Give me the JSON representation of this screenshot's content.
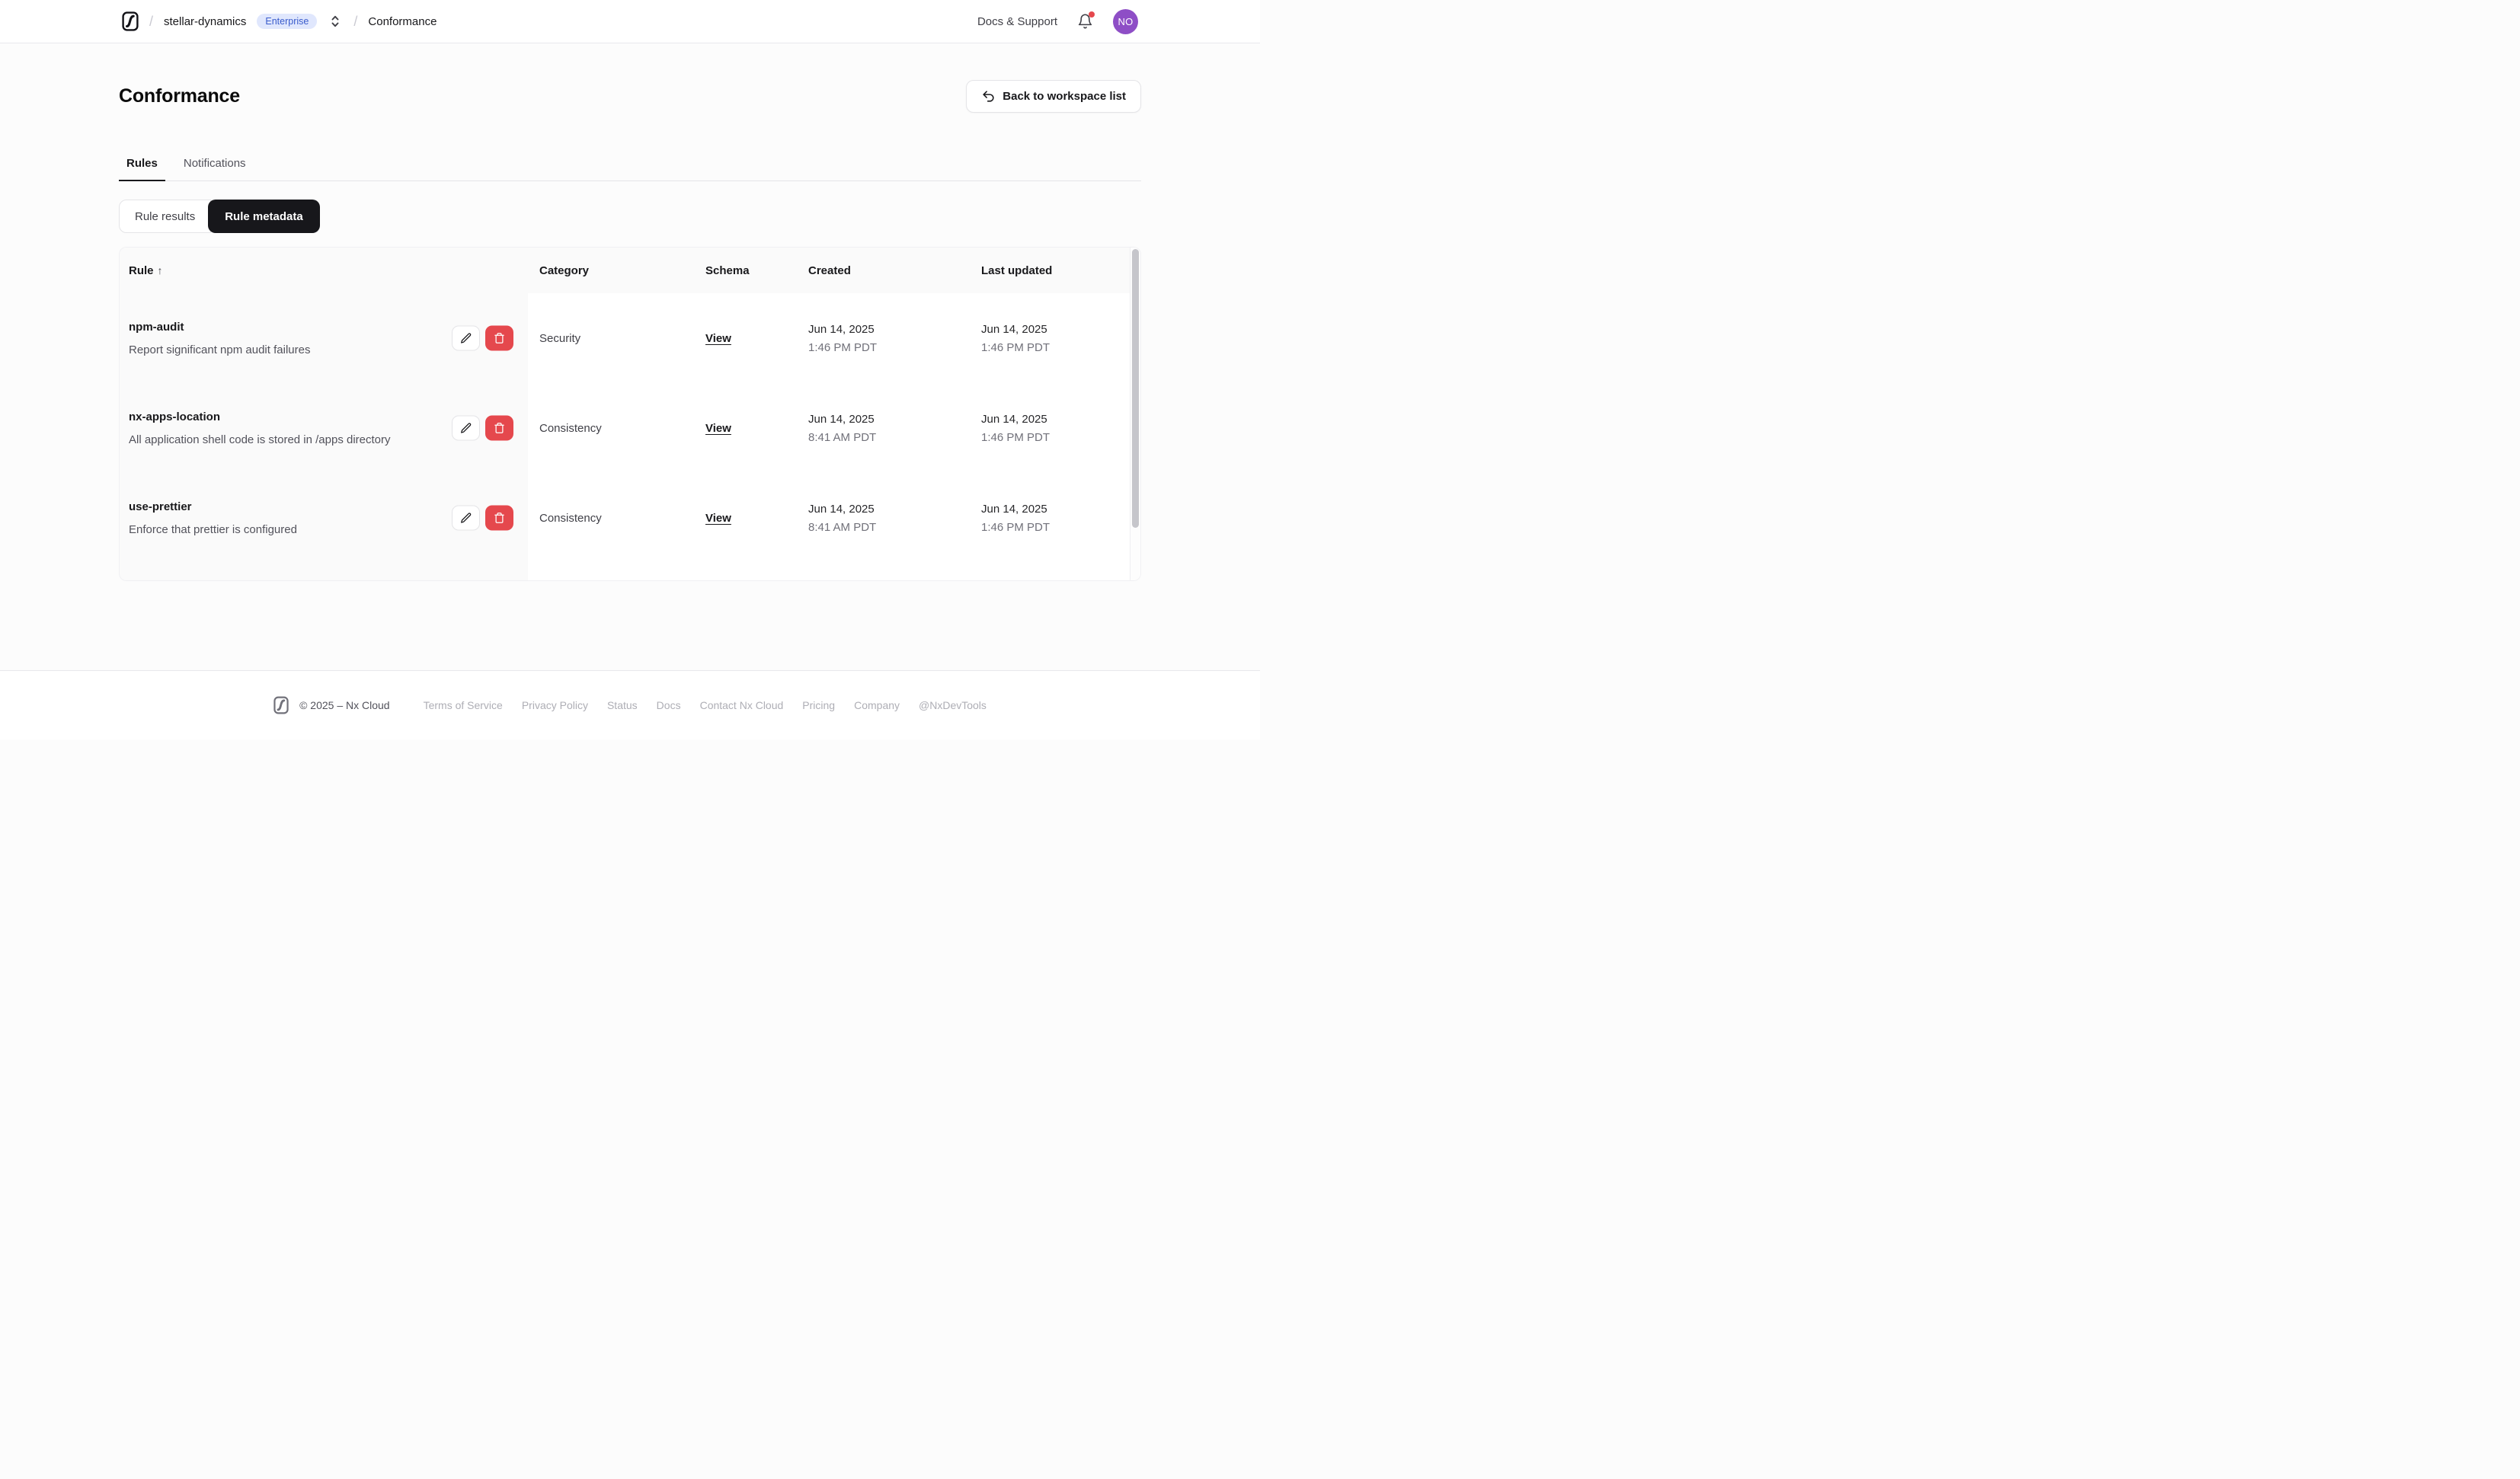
{
  "nav": {
    "breadcrumb": {
      "separator": "/",
      "workspace": "stellar-dynamics",
      "plan_badge": "Enterprise",
      "page": "Conformance"
    },
    "docs_support": "Docs & Support",
    "avatar_initials": "NO"
  },
  "page": {
    "title": "Conformance",
    "back_button": "Back to workspace list"
  },
  "tabs": [
    {
      "label": "Rules",
      "active": true
    },
    {
      "label": "Notifications",
      "active": false
    }
  ],
  "segmented": [
    {
      "label": "Rule results",
      "active": false
    },
    {
      "label": "Rule metadata",
      "active": true
    }
  ],
  "table": {
    "columns": [
      "Rule",
      "Category",
      "Schema",
      "Created",
      "Last updated"
    ],
    "sort_indicator": "↑",
    "rows": [
      {
        "name": "npm-audit",
        "description": "Report significant npm audit failures",
        "category": "Security",
        "schema_label": "View",
        "created_date": "Jun 14, 2025",
        "created_time": "1:46 PM PDT",
        "updated_date": "Jun 14, 2025",
        "updated_time": "1:46 PM PDT"
      },
      {
        "name": "nx-apps-location",
        "description": "All application shell code is stored in /apps directory",
        "category": "Consistency",
        "schema_label": "View",
        "created_date": "Jun 14, 2025",
        "created_time": "8:41 AM PDT",
        "updated_date": "Jun 14, 2025",
        "updated_time": "1:46 PM PDT"
      },
      {
        "name": "use-prettier",
        "description": "Enforce that prettier is configured",
        "category": "Consistency",
        "schema_label": "View",
        "created_date": "Jun 14, 2025",
        "created_time": "8:41 AM PDT",
        "updated_date": "Jun 14, 2025",
        "updated_time": "1:46 PM PDT"
      }
    ]
  },
  "footer": {
    "copyright": "© 2025 – Nx Cloud",
    "links": [
      "Terms of Service",
      "Privacy Policy",
      "Status",
      "Docs",
      "Contact Nx Cloud",
      "Pricing",
      "Company",
      "@NxDevTools"
    ]
  },
  "colors": {
    "badge_bg": "#e0e7fd",
    "badge_text": "#3a5ccc",
    "danger": "#e5484d",
    "avatar_bg": "#8e4ec6",
    "notification_dot": "#e5484d",
    "active_segment_bg": "#17171b"
  }
}
